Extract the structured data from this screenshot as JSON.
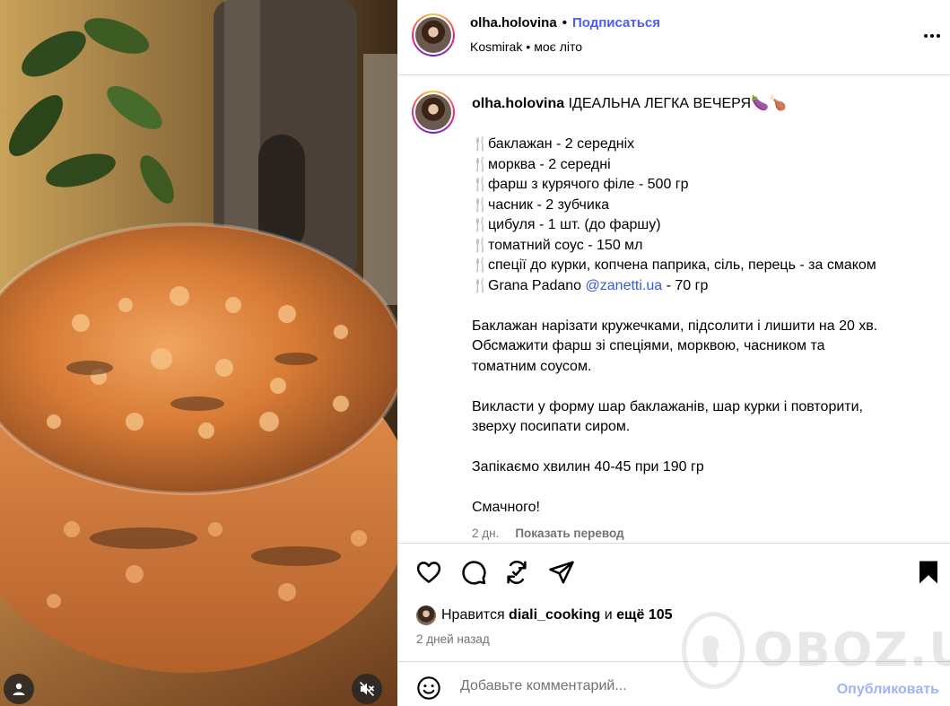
{
  "media": {
    "description_icons": {
      "user_tag": "user-tag-icon",
      "mute": "audio-muted-icon"
    }
  },
  "header": {
    "username": "olha.holovina",
    "separator": "•",
    "follow_label": "Подписаться",
    "location": "Kosmirak",
    "audio_separator": "•",
    "audio": "моє літо"
  },
  "caption": {
    "username": "olha.holovina",
    "title": "ІДЕАЛЬНА ЛЕГКА ВЕЧЕРЯ🍆🍗",
    "ingredient_icon": "🍴",
    "ingredients": [
      "баклажан - 2 середніх",
      "морква - 2 середні",
      "фарш з курячого філе - 500 гр",
      "часник - 2 зубчика",
      "цибуля - 1 шт. (до фаршу)",
      "томатний соус - 150 мл",
      "спеції до курки, копчена паприка, сіль, перець - за смаком"
    ],
    "last_ingredient_prefix": "Grana Padano ",
    "last_ingredient_mention": "@zanetti.ua",
    "last_ingredient_suffix": " - 70 гр",
    "step1_lines": [
      "Баклажан нарізати кружечками, підсолити і лишити на 20 хв.",
      "Обсмажити фарш зі спеціями, морквою, часником та",
      "томатним соусом."
    ],
    "step2_lines": [
      "Викласти у форму шар баклажанів, шар курки і повторити,",
      "зверху посипати сиром."
    ],
    "step3": "Запікаємо хвилин 40-45 при 190 гр",
    "closing": "Смачного!",
    "age": "2 дн.",
    "translate_label": "Показать перевод"
  },
  "actions": {
    "likes_prefix": "Нравится ",
    "liker": "diali_cooking",
    "likes_middle": " и ",
    "likes_more": "ещё 105",
    "date": "2 дней назад"
  },
  "comment": {
    "placeholder": "Добавьте комментарий...",
    "publish_label": "Опубликовать"
  },
  "watermark": {
    "text": "OBOZ.UA"
  },
  "colors": {
    "follow": "#4a5df9",
    "mention": "#3b5ccf",
    "publish_disabled": "#9fb4f5",
    "muted_text": "#737373",
    "divider": "#dbdbdb"
  }
}
